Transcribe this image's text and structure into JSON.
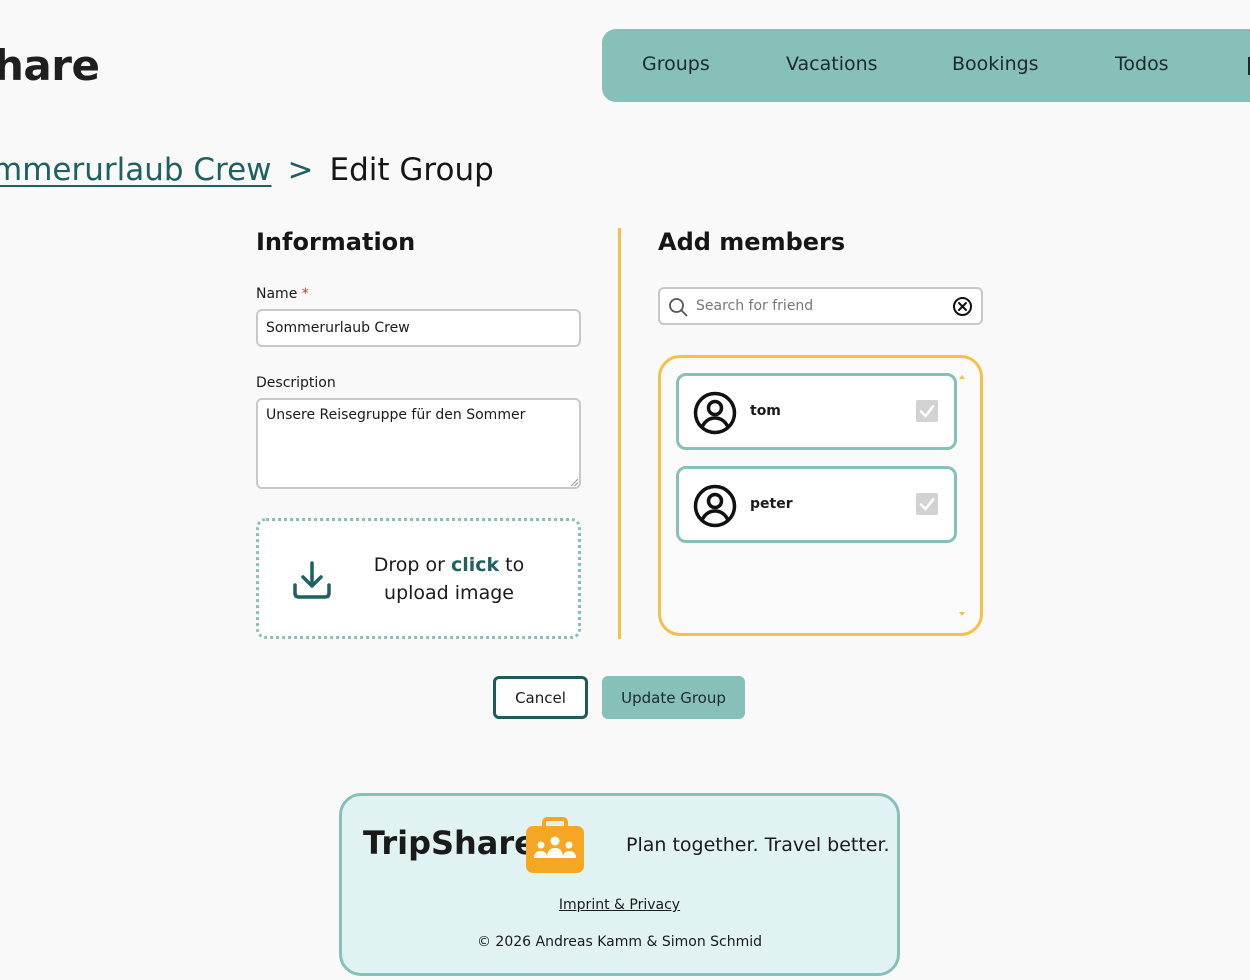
{
  "header": {
    "logo_text": "hare",
    "nav": [
      {
        "label": "Groups"
      },
      {
        "label": "Vacations"
      },
      {
        "label": "Bookings"
      },
      {
        "label": "Todos"
      }
    ]
  },
  "breadcrumb": {
    "parent": "mmerurlaub Crew",
    "separator": ">",
    "current": "Edit Group"
  },
  "information": {
    "title": "Information",
    "name_label": "Name",
    "required_mark": "*",
    "name_value": "Sommerurlaub Crew",
    "description_label": "Description",
    "description_value": "Unsere Reisegruppe für den Sommer",
    "upload": {
      "text_before": "Drop or ",
      "text_link": "click",
      "text_after": " to",
      "text_line2": "upload image"
    }
  },
  "members": {
    "title": "Add members",
    "search_placeholder": "Search for friend",
    "list": [
      {
        "name": "tom",
        "checked": true
      },
      {
        "name": "peter",
        "checked": true
      }
    ]
  },
  "actions": {
    "cancel_label": "Cancel",
    "update_label": "Update Group"
  },
  "footer": {
    "brand": "TripShare",
    "tagline": "Plan together. Travel better.",
    "link": "Imprint & Privacy",
    "copyright": "© 2026 Andreas Kamm & Simon Schmid"
  },
  "colors": {
    "teal": "#86c0b9",
    "dark_teal": "#1f6060",
    "accent_yellow": "#f5c04a",
    "footer_bg": "#e1f2f2",
    "logo_orange": "#f5a623"
  }
}
